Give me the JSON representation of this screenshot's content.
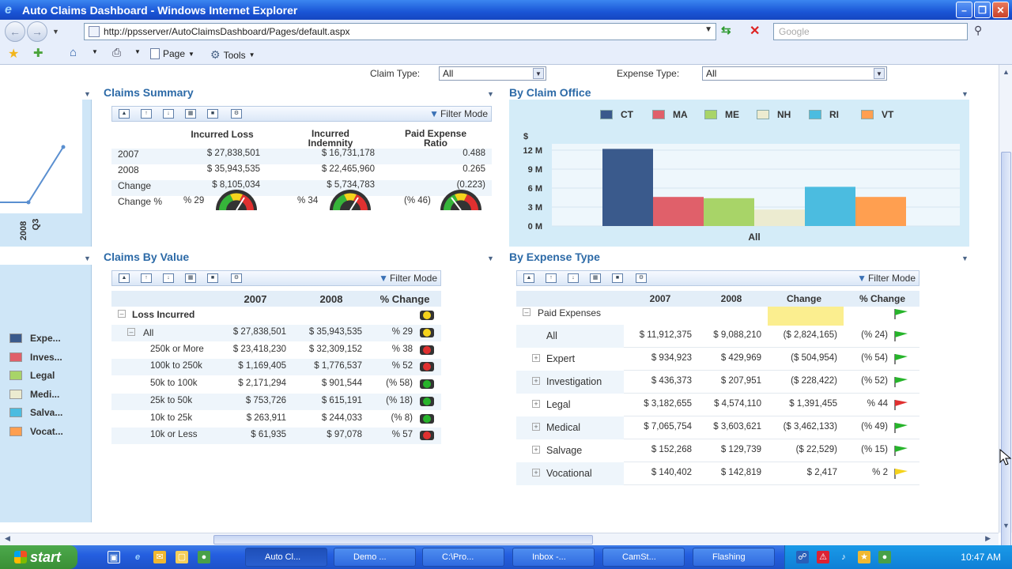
{
  "window": {
    "title": "Auto Claims Dashboard - Windows Internet Explorer"
  },
  "browser": {
    "url": "http://ppsserver/AutoClaimsDashboard/Pages/default.aspx",
    "search_placeholder": "Google",
    "page_menu": "Page",
    "tools_menu": "Tools"
  },
  "filters": {
    "claim_type_label": "Claim Type:",
    "claim_type_value": "All",
    "expense_type_label": "Expense Type:",
    "expense_type_value": "All"
  },
  "left_chart": {
    "label_year": "2008",
    "label_q": "Q3"
  },
  "left_legend": [
    {
      "label": "Expe...",
      "color": "#3a5a8c"
    },
    {
      "label": "Inves...",
      "color": "#e0606a"
    },
    {
      "label": "Legal",
      "color": "#a8d468"
    },
    {
      "label": "Medi...",
      "color": "#ecebd0"
    },
    {
      "label": "Salva...",
      "color": "#4bbce0"
    },
    {
      "label": "Vocat...",
      "color": "#ff9f50"
    }
  ],
  "claims_summary": {
    "title": "Claims Summary",
    "filter_mode": "Filter Mode",
    "columns": [
      "Incurred Loss",
      "Incurred Indemnity",
      "Paid Expense Ratio"
    ],
    "col2_line1": "Incurred",
    "col2_line2": "Indemnity",
    "col3_line1": "Paid Expense",
    "col3_line2": "Ratio",
    "rows": [
      {
        "label": "2007",
        "loss": "$ 27,838,501",
        "indemnity": "$ 16,731,178",
        "ratio": "0.488"
      },
      {
        "label": "2008",
        "loss": "$ 35,943,535",
        "indemnity": "$ 22,465,960",
        "ratio": "0.265"
      },
      {
        "label": "Change",
        "loss": "$ 8,105,034",
        "indemnity": "$ 5,734,783",
        "ratio": "(0.223)"
      },
      {
        "label": "Change %",
        "loss": "% 29",
        "indemnity": "% 34",
        "ratio": "(% 46)"
      }
    ]
  },
  "by_claim_office": {
    "title": "By Claim Office",
    "ylabel": "$",
    "ticks": [
      "12 M",
      "9 M",
      "6 M",
      "3 M",
      "0 M"
    ],
    "category": "All"
  },
  "chart_data": {
    "type": "bar",
    "categories": [
      "All"
    ],
    "ylabel": "$",
    "ylim": [
      0,
      12
    ],
    "series": [
      {
        "name": "CT",
        "values": [
          12.2
        ],
        "color": "#3a5a8c"
      },
      {
        "name": "MA",
        "values": [
          4.6
        ],
        "color": "#e0606a"
      },
      {
        "name": "ME",
        "values": [
          4.4
        ],
        "color": "#a8d468"
      },
      {
        "name": "NH",
        "values": [
          2.6
        ],
        "color": "#ecebd0"
      },
      {
        "name": "RI",
        "values": [
          6.2
        ],
        "color": "#4bbce0"
      },
      {
        "name": "VT",
        "values": [
          4.6
        ],
        "color": "#ff9f50"
      }
    ]
  },
  "claims_by_value": {
    "title": "Claims By Value",
    "filter_mode": "Filter Mode",
    "col_2007": "2007",
    "col_2008": "2008",
    "col_change": "% Change",
    "group_label": "Loss Incurred",
    "rows": [
      {
        "label": "All",
        "v2007": "$ 27,838,501",
        "v2008": "$ 35,943,535",
        "change": "% 29",
        "status": "yellow"
      },
      {
        "label": "250k or More",
        "v2007": "$ 23,418,230",
        "v2008": "$ 32,309,152",
        "change": "% 38",
        "status": "red"
      },
      {
        "label": "100k to 250k",
        "v2007": "$ 1,169,405",
        "v2008": "$ 1,776,537",
        "change": "% 52",
        "status": "red"
      },
      {
        "label": "50k to 100k",
        "v2007": "$ 2,171,294",
        "v2008": "$ 901,544",
        "change": "(% 58)",
        "status": "green"
      },
      {
        "label": "25k to 50k",
        "v2007": "$ 753,726",
        "v2008": "$ 615,191",
        "change": "(% 18)",
        "status": "green"
      },
      {
        "label": "10k to 25k",
        "v2007": "$ 263,911",
        "v2008": "$ 244,033",
        "change": "(% 8)",
        "status": "green"
      },
      {
        "label": "10k or Less",
        "v2007": "$ 61,935",
        "v2008": "$ 97,078",
        "change": "% 57",
        "status": "red"
      }
    ]
  },
  "by_expense_type": {
    "title": "By Expense Type",
    "filter_mode": "Filter Mode",
    "col_2007": "2007",
    "col_2008": "2008",
    "col_change": "Change",
    "col_pct": "% Change",
    "group_label": "Paid Expenses",
    "rows": [
      {
        "label": "All",
        "v2007": "$ 11,912,375",
        "v2008": "$ 9,088,210",
        "change": "($ 2,824,165)",
        "pct": "(% 24)",
        "flag": "green"
      },
      {
        "label": "Expert",
        "v2007": "$ 934,923",
        "v2008": "$ 429,969",
        "change": "($ 504,954)",
        "pct": "(% 54)",
        "flag": "green"
      },
      {
        "label": "Investigation",
        "v2007": "$ 436,373",
        "v2008": "$ 207,951",
        "change": "($ 228,422)",
        "pct": "(% 52)",
        "flag": "green"
      },
      {
        "label": "Legal",
        "v2007": "$ 3,182,655",
        "v2008": "$ 4,574,110",
        "change": "$ 1,391,455",
        "pct": "% 44",
        "flag": "red"
      },
      {
        "label": "Medical",
        "v2007": "$ 7,065,754",
        "v2008": "$ 3,603,621",
        "change": "($ 3,462,133)",
        "pct": "(% 49)",
        "flag": "green"
      },
      {
        "label": "Salvage",
        "v2007": "$ 152,268",
        "v2008": "$ 129,739",
        "change": "($ 22,529)",
        "pct": "(% 15)",
        "flag": "green"
      },
      {
        "label": "Vocational",
        "v2007": "$ 140,402",
        "v2008": "$ 142,819",
        "change": "$ 2,417",
        "pct": "% 2",
        "flag": "yellow"
      }
    ]
  },
  "taskbar": {
    "start": "start",
    "items": [
      "Auto Cl...",
      "Demo ...",
      "C:\\Pro...",
      "Inbox -...",
      "CamSt...",
      "Flashing"
    ],
    "time": "10:47 AM"
  },
  "colors": {
    "status_green": "#27b42b",
    "status_red": "#e03030",
    "status_yellow": "#f5d31c",
    "title_blue": "#2c6aa7"
  }
}
